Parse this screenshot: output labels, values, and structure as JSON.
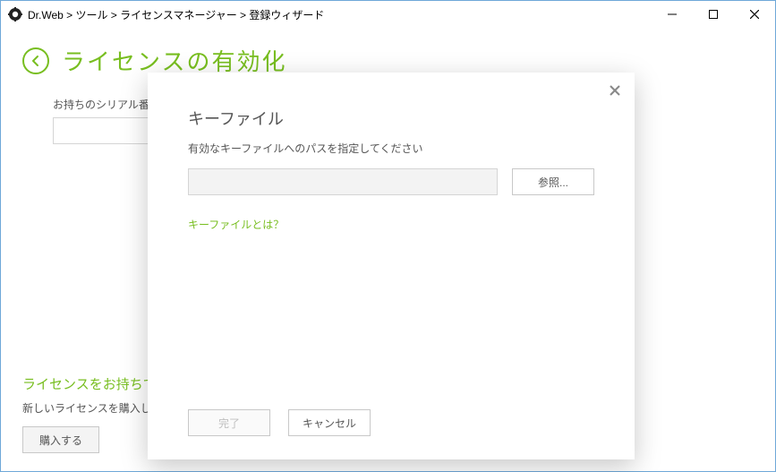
{
  "window": {
    "breadcrumb": "Dr.Web > ツール > ライセンスマネージャー > 登録ウィザード"
  },
  "main": {
    "page_title": "ライセンスの有効化",
    "serial_label": "お持ちのシリアル番号を入力してください",
    "serial_value": "",
    "license_need_title": "ライセンスをお持ちでない場合",
    "license_need_sub": "新しいライセンスを購入してください",
    "buy_label": "購入する"
  },
  "dialog": {
    "title": "キーファイル",
    "instruction": "有効なキーファイルへのパスを指定してください",
    "path_value": "",
    "browse_label": "参照...",
    "help_link": "キーファイルとは？",
    "finish_label": "完了",
    "cancel_label": "キャンセル"
  }
}
